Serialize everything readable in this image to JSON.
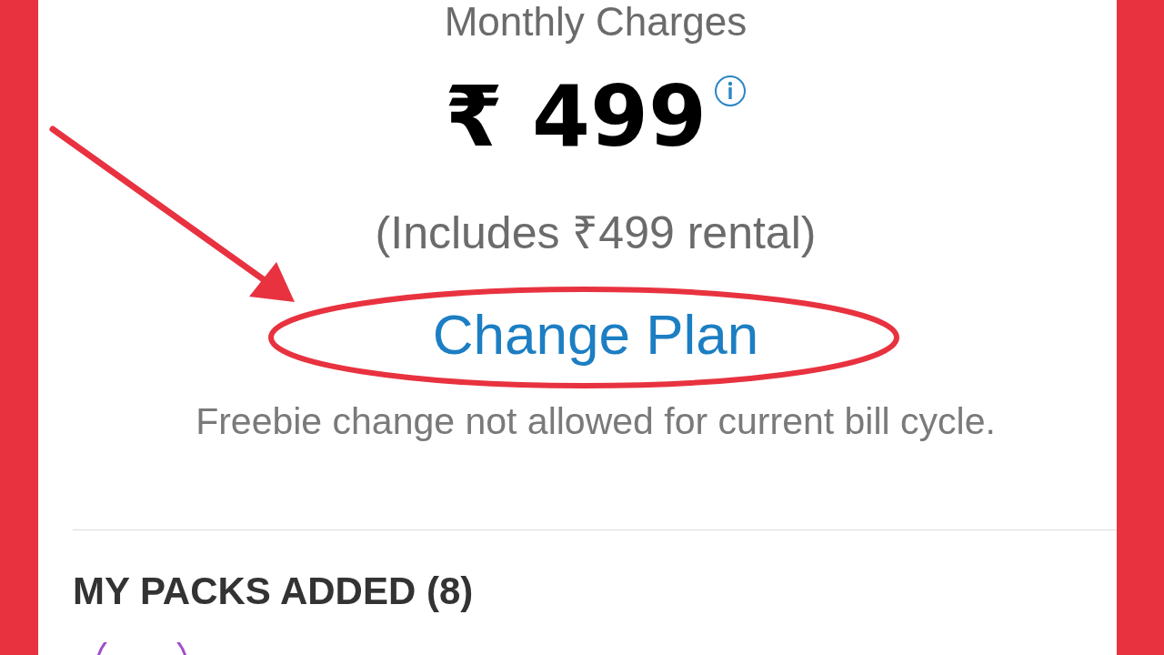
{
  "header": {
    "title": "Monthly Charges"
  },
  "price": {
    "amount": "₹ 499"
  },
  "rental_note": "(Includes ₹499 rental)",
  "change_plan_link": "Change Plan",
  "notice": "Freebie change not allowed for current bill cycle.",
  "packs_section": {
    "title": "MY PACKS ADDED (8)"
  }
}
